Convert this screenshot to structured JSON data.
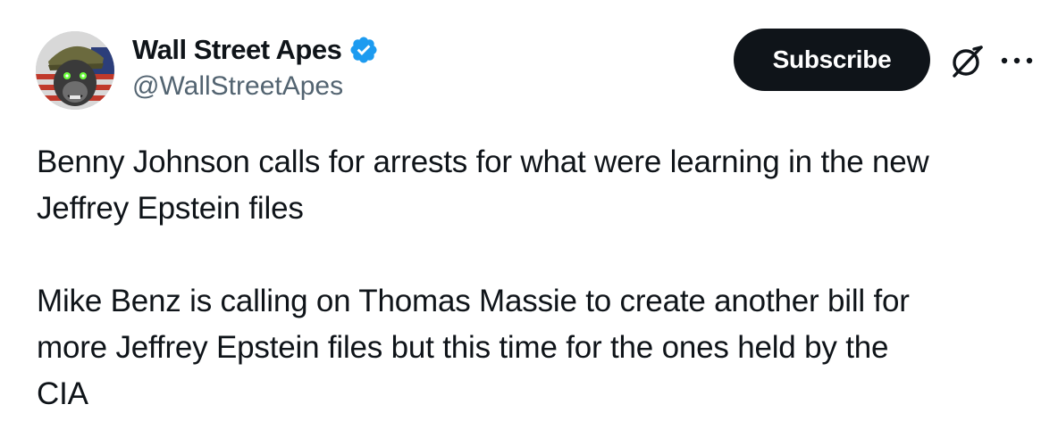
{
  "author": {
    "display_name": "Wall Street Apes",
    "handle": "@WallStreetApes",
    "verified": true,
    "avatar_icon": "gorilla-helmet-avatar"
  },
  "actions": {
    "subscribe_label": "Subscribe",
    "grok_icon": "grok-icon",
    "more_icon": "more-options-icon"
  },
  "tweet": {
    "paragraphs": [
      "Benny Johnson calls for arrests for what were learning in the new\nJeffrey Epstein files",
      "Mike Benz is calling on Thomas Massie to create another bill for\nmore Jeffrey Epstein files but this time for the ones held by the\nCIA"
    ]
  },
  "colors": {
    "text": "#0f1419",
    "secondary_text": "#536471",
    "verified_blue": "#1d9bf0",
    "button_bg": "#0f1419"
  }
}
